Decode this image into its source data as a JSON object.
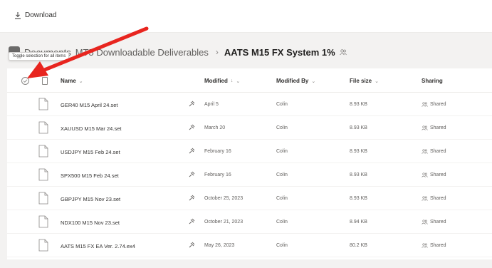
{
  "toolbar": {
    "download_label": "Download"
  },
  "breadcrumb": {
    "items": [
      "Documents",
      "MT5 Downloadable Deliverables"
    ],
    "current": "AATS M15 FX System 1%"
  },
  "tooltip": "Toggle selection for all items",
  "columns": {
    "name": "Name",
    "modified": "Modified",
    "modified_by": "Modified By",
    "file_size": "File size",
    "sharing": "Sharing"
  },
  "files": [
    {
      "name": "GER40 M15 April 24.set",
      "modified": "April 5",
      "modified_by": "Colin",
      "size": "8.93 KB",
      "sharing": "Shared"
    },
    {
      "name": "XAUUSD M15  Mar 24.set",
      "modified": "March 20",
      "modified_by": "Colin",
      "size": "8.93 KB",
      "sharing": "Shared"
    },
    {
      "name": "USDJPY M15 Feb 24.set",
      "modified": "February 16",
      "modified_by": "Colin",
      "size": "8.93 KB",
      "sharing": "Shared"
    },
    {
      "name": "SPX500 M15 Feb 24.set",
      "modified": "February 16",
      "modified_by": "Colin",
      "size": "8.93 KB",
      "sharing": "Shared"
    },
    {
      "name": "GBPJPY M15 Nov 23.set",
      "modified": "October 25, 2023",
      "modified_by": "Colin",
      "size": "8.93 KB",
      "sharing": "Shared"
    },
    {
      "name": "NDX100 M15 Nov 23.set",
      "modified": "October 21, 2023",
      "modified_by": "Colin",
      "size": "8.94 KB",
      "sharing": "Shared"
    },
    {
      "name": "AATS M15 FX EA Ver. 2.74.ex4",
      "modified": "May 26, 2023",
      "modified_by": "Colin",
      "size": "80.2 KB",
      "sharing": "Shared"
    }
  ],
  "annotation": {
    "arrow_color": "#e8251f"
  }
}
